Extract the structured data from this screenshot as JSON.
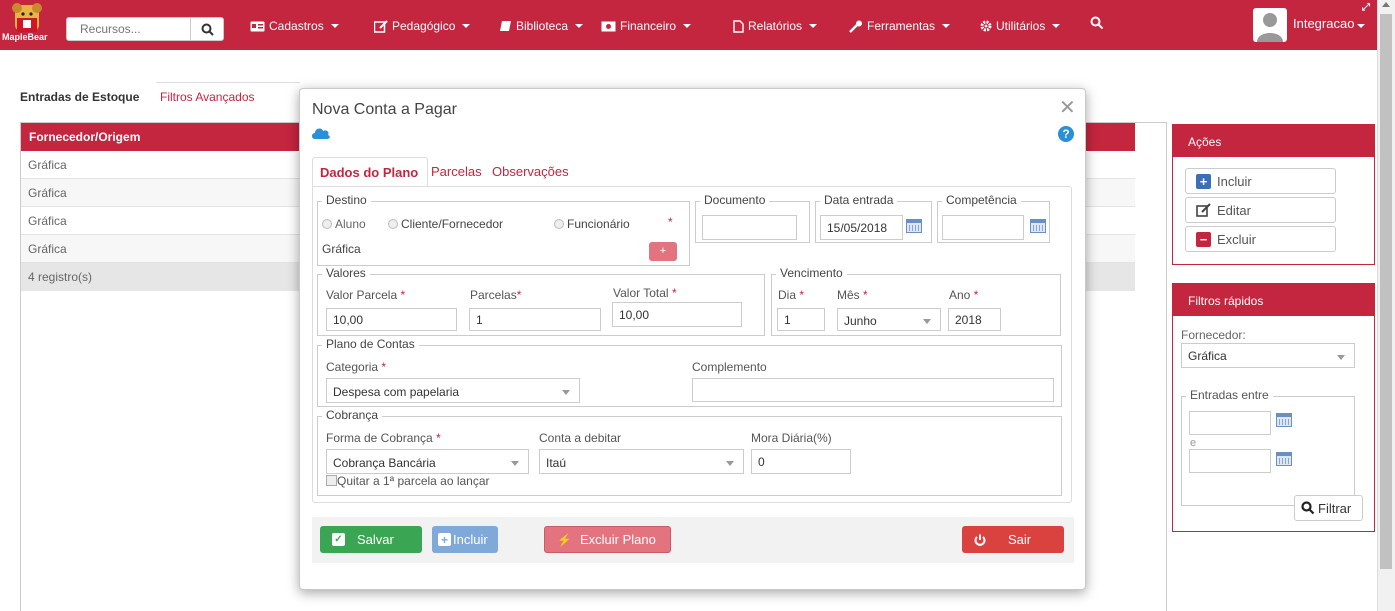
{
  "navbar": {
    "logo_text": "MapleBear",
    "search_placeholder": "Recursos...",
    "menus": [
      "Cadastros",
      "Pedagógico",
      "Biblioteca",
      "Financeiro",
      "Relatórios",
      "Ferramentas",
      "Utilitários"
    ],
    "user_name": "Integracao"
  },
  "background": {
    "tabs": [
      "Entradas de Estoque",
      "Filtros Avançados"
    ],
    "table_header": "Fornecedor/Origem",
    "rows": [
      "Gráfica",
      "Gráfica",
      "Gráfica",
      "Gráfica"
    ],
    "count": "4 registro(s)"
  },
  "actions_panel": {
    "title": "Ações",
    "include": "Incluir",
    "edit": "Editar",
    "delete": "Excluir"
  },
  "quick_filters": {
    "title": "Filtros rápidos",
    "supplier_label": "Fornecedor:",
    "supplier_value": "Gráfica",
    "between_legend": "Entradas entre",
    "and_label": "e",
    "filter_button": "Filtrar"
  },
  "modal": {
    "title": "Nova Conta a Pagar",
    "tabs": [
      "Dados do Plano",
      "Parcelas",
      "Observações"
    ],
    "destino": {
      "legend": "Destino",
      "options": [
        "Aluno",
        "Cliente/Fornecedor",
        "Funcionário"
      ],
      "selected_name": "Gráfica",
      "add_button": "+"
    },
    "documento": {
      "legend": "Documento",
      "value": ""
    },
    "data_entrada": {
      "legend": "Data entrada",
      "value": "15/05/2018"
    },
    "competencia": {
      "legend": "Competência",
      "value": ""
    },
    "valores": {
      "legend": "Valores",
      "valor_parcela_label": "Valor Parcela",
      "valor_parcela": "10,00",
      "parcelas_label": "Parcelas",
      "parcelas": "1",
      "valor_total_label": "Valor Total",
      "valor_total": "10,00"
    },
    "vencimento": {
      "legend": "Vencimento",
      "dia_label": "Dia",
      "dia": "1",
      "mes_label": "Mês",
      "mes": "Junho",
      "ano_label": "Ano",
      "ano": "2018"
    },
    "plano": {
      "legend": "Plano de Contas",
      "categoria_label": "Categoria",
      "categoria": "Despesa com papelaria",
      "complemento_label": "Complemento",
      "complemento": ""
    },
    "cobranca": {
      "legend": "Cobrança",
      "forma_label": "Forma de Cobrança",
      "forma": "Cobrança Bancária",
      "conta_label": "Conta a debitar",
      "conta": "Itaú",
      "mora_label": "Mora Diária(%)",
      "mora": "0",
      "quitar_label": "Quitar a 1ª parcela ao lançar"
    },
    "buttons": {
      "save": "Salvar",
      "include": "Incluir",
      "delete_plan": "Excluir Plano",
      "exit": "Sair"
    }
  },
  "colors": {
    "brand": "#c4253f",
    "save": "#3aa653",
    "include": "#7fa9d8",
    "delete_plan": "#e3747f",
    "exit": "#d9423f"
  }
}
